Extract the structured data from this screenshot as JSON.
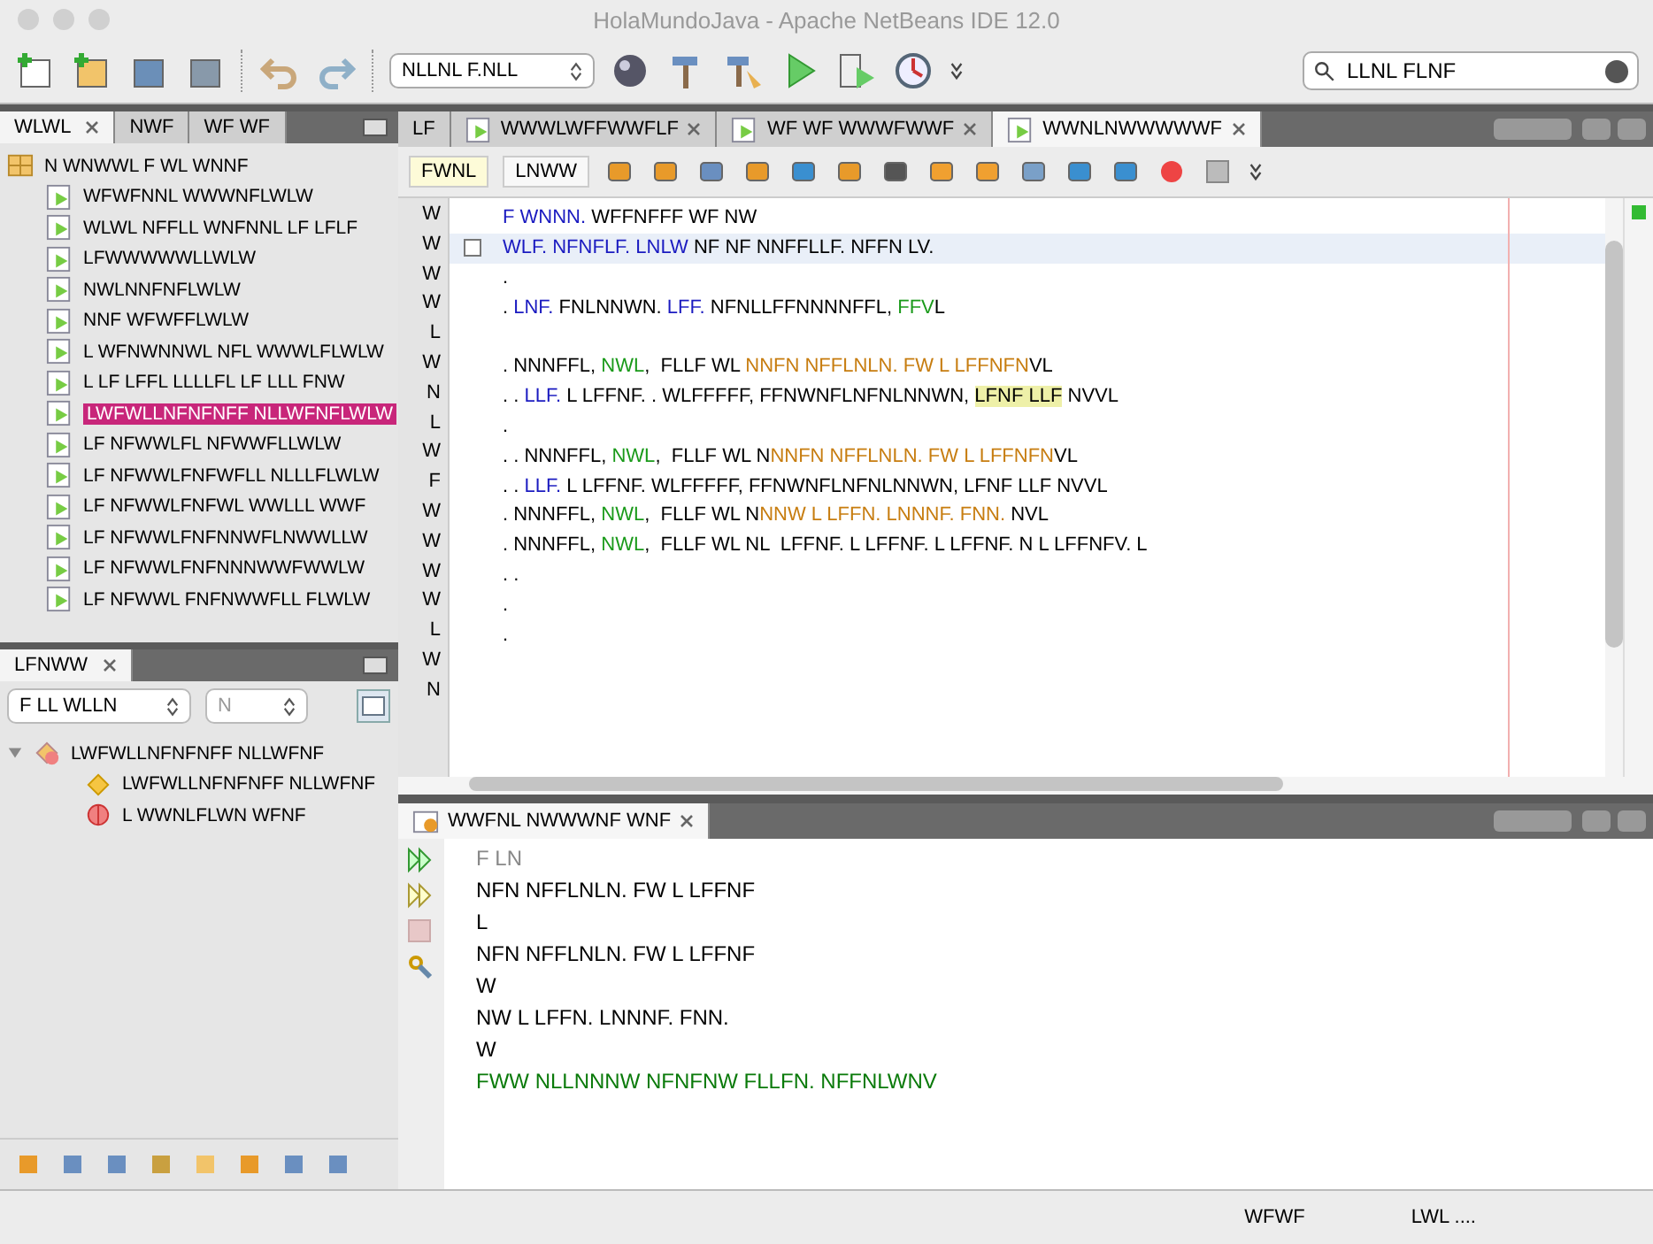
{
  "window": {
    "title": "HolaMundoJava - Apache NetBeans IDE 12.0"
  },
  "toolbar": {
    "config": "NLLNL F.NLL",
    "search": "LLNL FLNF"
  },
  "projects": {
    "tabs": [
      {
        "label": "WLWL",
        "selected": true
      },
      {
        "label": "NWF",
        "selected": false
      },
      {
        "label": "WF WF",
        "selected": false
      }
    ],
    "tree": {
      "label": "N WNWWL F WL WNNF",
      "children": [
        {
          "label": "WFWFNNL WWWNFLWLW",
          "selected": false
        },
        {
          "label": "WLWL NFFLL WNFNNL LF LFLF",
          "selected": false
        },
        {
          "label": "LFWWWWWLLWLW",
          "selected": false
        },
        {
          "label": "NWLNNFNFLWLW",
          "selected": false
        },
        {
          "label": "NNF WFWFFLWLW",
          "selected": false
        },
        {
          "label": "L WFNWNNWL NFL WWWLFLWLW",
          "selected": false
        },
        {
          "label": "L LF LFFL LLLLFL LF LLL FNW",
          "selected": false
        },
        {
          "label": "LWFWLLNFNFNFF NLLWFNFLWLW",
          "selected": true
        },
        {
          "label": "LF NFWWLFL NFWWFLLWLW",
          "selected": false
        },
        {
          "label": "LF NFWWLFNFWFLL NLLLFLWLW",
          "selected": false
        },
        {
          "label": "LF NFWWLFNFWL WWLLL WWF",
          "selected": false
        },
        {
          "label": "LF NFWWLFNFNNWFLNWWLLW",
          "selected": false
        },
        {
          "label": "LF NFWWLFNFNNNWWFWWLW",
          "selected": false
        },
        {
          "label": "LF NFWWL FNFNWWFLL FLWLW",
          "selected": false
        }
      ]
    }
  },
  "navigator": {
    "tab": "LFNWW",
    "combo": "F LL WLLN",
    "combo2": "N",
    "tree": {
      "label": "LWFWLLNFNFNFF NLLWFNF",
      "expanded": true,
      "children": [
        {
          "label": "LWFWLLNFNFNFF NLLWFNF",
          "kind": "field"
        },
        {
          "label": "L WWNLFLWN WFNF",
          "kind": "method"
        }
      ]
    }
  },
  "editor": {
    "tabs": [
      {
        "label": "LF",
        "selected": false
      },
      {
        "label": "WWWLWFFWWFLF",
        "selected": false
      },
      {
        "label": "WF WF WWWFWWF",
        "selected": false
      },
      {
        "label": "WWNLNWWWWWF",
        "selected": true
      }
    ],
    "view_buttons": [
      {
        "label": "FWNL",
        "selected": true
      },
      {
        "label": "LNWW",
        "selected": false
      }
    ],
    "line_numbers": [
      "W",
      "W",
      "W",
      "W",
      "L",
      "W",
      "N",
      "L",
      "W",
      "F",
      "W",
      "W",
      "W",
      "W",
      "L",
      "W",
      "N"
    ],
    "lines": [
      {
        "current": false,
        "space_before": false,
        "segments": [
          {
            "text": "F WNNN. ",
            "kind": "keyword"
          },
          {
            "text": "WFFNFFF WF NW",
            "kind": "plain"
          }
        ]
      },
      {
        "current": true,
        "space_before": false,
        "segments": [
          {
            "text": "WLF. NFNFLF. LNLW",
            "kind": "keyword"
          },
          {
            "text": " NF NF NNFFLLF. NFFN LV.",
            "kind": "plain"
          }
        ]
      },
      {
        "current": false,
        "space_before": false,
        "segments": [
          {
            "text": ".",
            "kind": "plain"
          }
        ]
      },
      {
        "current": false,
        "space_before": false,
        "segments": [
          {
            "text": ". ",
            "kind": "plain"
          },
          {
            "text": "LNF.",
            "kind": "keyword"
          },
          {
            "text": " FNLNNWN. ",
            "kind": "plain"
          },
          {
            "text": "LFF.",
            "kind": "keyword"
          },
          {
            "text": " NFNLLFFNNNNFFL, ",
            "kind": "plain"
          },
          {
            "text": "FFV",
            "kind": "green"
          },
          {
            "text": "L",
            "kind": "plain"
          }
        ]
      },
      {
        "current": false,
        "space_before": true,
        "segments": [
          {
            "text": ". NNNFFL, ",
            "kind": "plain"
          },
          {
            "text": "NWL",
            "kind": "green"
          },
          {
            "text": ",  FLLF WL ",
            "kind": "plain"
          },
          {
            "text": "NNFN NFFLNLN. FW L LFFNFN",
            "kind": "string"
          },
          {
            "text": "VL",
            "kind": "plain"
          }
        ]
      },
      {
        "current": false,
        "space_before": false,
        "segments": [
          {
            "text": ". . ",
            "kind": "plain"
          },
          {
            "text": "LLF.",
            "kind": "keyword"
          },
          {
            "text": " L LFFNF. . WLFFFFF, FFNWNFLNFNLNNWN, ",
            "kind": "plain"
          },
          {
            "text": "LFNF LLF",
            "kind": "mark"
          },
          {
            "text": " NVVL",
            "kind": "plain"
          }
        ]
      },
      {
        "current": false,
        "space_before": false,
        "segments": [
          {
            "text": ".",
            "kind": "plain"
          }
        ]
      },
      {
        "current": false,
        "space_before": false,
        "segments": [
          {
            "text": ". . NNNFFL, ",
            "kind": "plain"
          },
          {
            "text": "NWL",
            "kind": "green"
          },
          {
            "text": ",  FLLF WL N",
            "kind": "plain"
          },
          {
            "text": "NNFN NFFLNLN. FW L LFFNFN",
            "kind": "string"
          },
          {
            "text": "VL",
            "kind": "plain"
          }
        ]
      },
      {
        "current": false,
        "space_before": false,
        "segments": [
          {
            "text": ". . ",
            "kind": "plain"
          },
          {
            "text": "LLF.",
            "kind": "keyword"
          },
          {
            "text": " L LFFNF. WLFFFFF, FFNWNFLNFNLNNWN, LFNF LLF NVVL",
            "kind": "plain"
          }
        ]
      },
      {
        "current": false,
        "space_before": false,
        "segments": [
          {
            "text": ". NNNFFL, ",
            "kind": "plain"
          },
          {
            "text": "NWL",
            "kind": "green"
          },
          {
            "text": ",  FLLF WL N",
            "kind": "plain"
          },
          {
            "text": "NNW L LFFN. LNNNF. FNN.",
            "kind": "string"
          },
          {
            "text": " NVL",
            "kind": "plain"
          }
        ]
      },
      {
        "current": false,
        "space_before": false,
        "segments": [
          {
            "text": ". NNNFFL, ",
            "kind": "plain"
          },
          {
            "text": "NWL",
            "kind": "green"
          },
          {
            "text": ",  FLLF WL NL  LFFNF. L LFFNF. L LFFNF. N L LFFNFV. L",
            "kind": "plain"
          }
        ]
      },
      {
        "current": false,
        "space_before": false,
        "segments": [
          {
            "text": ". .",
            "kind": "plain"
          }
        ]
      },
      {
        "current": false,
        "space_before": false,
        "segments": [
          {
            "text": ".",
            "kind": "plain"
          }
        ]
      },
      {
        "current": false,
        "space_before": false,
        "segments": [
          {
            "text": ".",
            "kind": "plain"
          }
        ]
      }
    ]
  },
  "output": {
    "tab": "WWFNL NWWWNF WNF",
    "lines": [
      {
        "text": "F LN",
        "kind": "muted"
      },
      {
        "text": "NFN NFFLNLN. FW L LFFNF",
        "kind": "plain"
      },
      {
        "text": "L",
        "kind": "plain"
      },
      {
        "text": "NFN NFFLNLN. FW L LFFNF",
        "kind": "plain"
      },
      {
        "text": "W",
        "kind": "plain"
      },
      {
        "text": "NW L LFFN. LNNNF. FNN.",
        "kind": "plain"
      },
      {
        "text": "W",
        "kind": "plain"
      },
      {
        "text": "FWW NLLNNNW NFNFNW FLLFN. NFFNLWNV",
        "kind": "success"
      }
    ]
  },
  "status_bar": {
    "items": [
      "WFWF",
      "LWL ...."
    ]
  }
}
